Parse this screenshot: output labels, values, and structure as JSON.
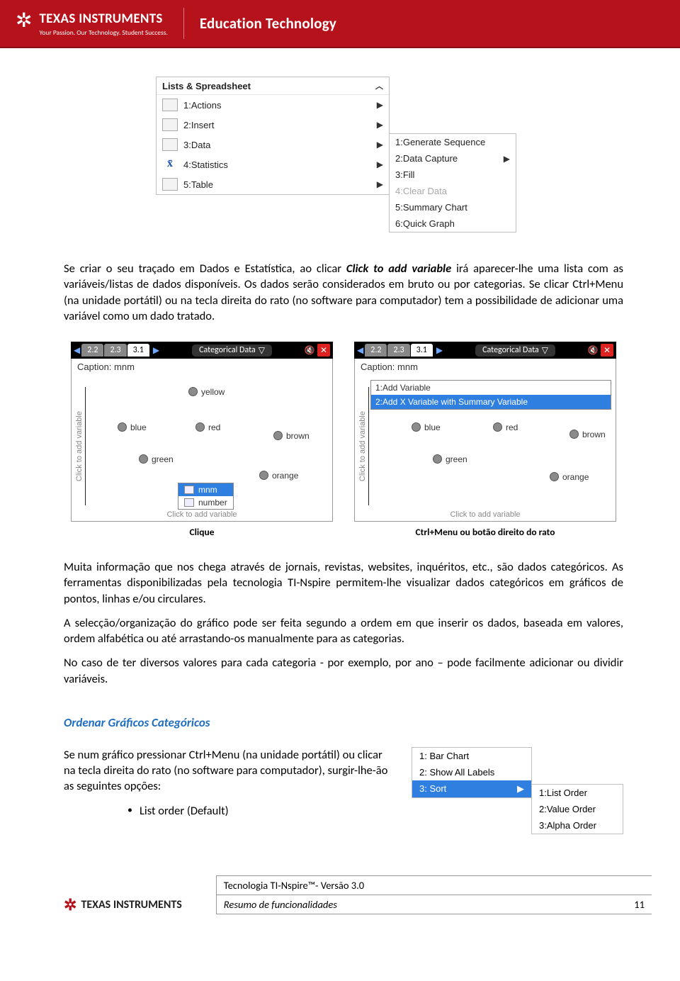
{
  "header": {
    "brand": "TEXAS INSTRUMENTS",
    "tagline": "Your Passion. Our Technology. Student Success.",
    "section": "Education Technology"
  },
  "spreadsheet_menu": {
    "title": "Lists & Spreadsheet",
    "items": [
      {
        "label": "1:Actions"
      },
      {
        "label": "2:Insert"
      },
      {
        "label": "3:Data"
      },
      {
        "label": "4:Statistics"
      },
      {
        "label": "5:Table"
      }
    ],
    "sub_items": [
      {
        "label": "1:Generate Sequence"
      },
      {
        "label": "2:Data Capture",
        "arrow": true
      },
      {
        "label": "3:Fill"
      },
      {
        "label": "4:Clear Data",
        "disabled": true
      },
      {
        "label": "5:Summary Chart"
      },
      {
        "label": "6:Quick Graph"
      }
    ]
  },
  "para1_a": "Se criar o seu traçado em Dados e Estatística, ao clicar ",
  "para1_b": "Click to add variable",
  "para1_c": " irá aparecer-lhe uma lista com as variáveis/listas de dados disponíveis. Os dados serão considerados em bruto ou por categorias. Se clicar Ctrl+Menu (na unidade portátil) ou na tecla direita do rato (no software para computador) tem a possibilidade de adicionar uma variável como um dado tratado.",
  "calc": {
    "tabs": [
      "2.2",
      "2.3",
      "3.1"
    ],
    "title": "Categorical Data",
    "caption": "Caption: mnm",
    "vlabel": "Click to add variable",
    "bottom": "Click to add variable",
    "dots": [
      "yellow",
      "blue",
      "red",
      "brown",
      "green",
      "orange"
    ],
    "popup": [
      "mnm",
      "number"
    ],
    "add_var_menu": [
      "1:Add Variable",
      "2:Add X Variable with Summary Variable"
    ]
  },
  "shot_captions": {
    "left": "Clique",
    "right": "Ctrl+Menu ou botão direito do rato"
  },
  "para2": "Muita informação que nos chega através de jornais, revistas, websites, inquéritos, etc., são dados categóricos.  As ferramentas disponibilizadas pela tecnologia TI-Nspire permitem-lhe visualizar dados categóricos em gráficos de pontos, linhas e/ou circulares.",
  "para3": "A selecção/organização do gráfico pode ser feita segundo a ordem em que inserir os dados, baseada em valores, ordem alfabética ou até arrastando-os manualmente para as categorias.",
  "para4": "No caso de ter diversos valores para cada categoria - por exemplo, por ano – pode facilmente adicionar ou dividir variáveis.",
  "section_head": "Ordenar Gráficos Categóricos",
  "sort_para": "Se num gráfico pressionar Ctrl+Menu (na unidade portátil) ou clicar na tecla direita do rato (no software para computador), surgir-lhe-ão as seguintes opções:",
  "bullet1": "List order (Default)",
  "sort_menu_main": [
    "1: Bar Chart",
    "2: Show All Labels",
    "3: Sort"
  ],
  "sort_menu_sub": [
    "1:List Order",
    "2:Value Order",
    "3:Alpha Order"
  ],
  "footer": {
    "brand": "TEXAS INSTRUMENTS",
    "line1": "Tecnologia TI-Nspire™- Versão 3.0",
    "line2": "Resumo de funcionalidades",
    "page": "11"
  }
}
